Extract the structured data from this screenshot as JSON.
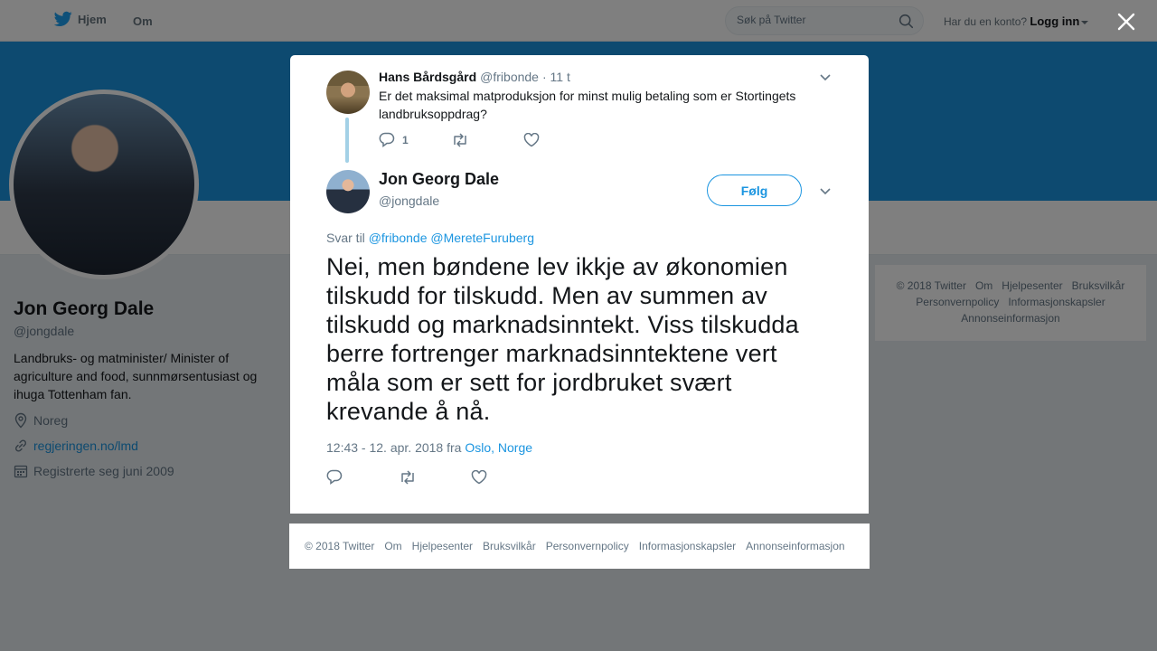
{
  "nav": {
    "home_label": "Hjem",
    "about_label": "Om",
    "search_placeholder": "Søk på Twitter",
    "login_prompt": "Har du en konto?",
    "login_label": "Logg inn"
  },
  "profile": {
    "name": "Jon Georg Dale",
    "handle": "@jongdale",
    "bio": "Landbruks- og matminister/ Minister of agriculture and food, sunnmørsentusiast og ihuga Tottenham fan.",
    "location": "Noreg",
    "website": "regjeringen.no/lmd",
    "joined": "Registrerte seg juni 2009"
  },
  "side_footer": [
    "© 2018 Twitter",
    "Om",
    "Hjelpesenter",
    "Bruksvilkår",
    "Personvernpolicy",
    "Informasjonskapsler",
    "Annonseinformasjon"
  ],
  "parent_tweet": {
    "name": "Hans Bårdsgård",
    "handle": "@fribonde",
    "time": "· 11 t",
    "text": "Er det maksimal matproduksjon for minst mulig betaling som er Stortingets landbruksoppdrag?",
    "reply_count": "1"
  },
  "main_tweet": {
    "name": "Jon Georg Dale",
    "handle": "@jongdale",
    "follow_label": "Følg",
    "reply_prefix": "Svar til",
    "reply_mention1": "@fribonde",
    "reply_mention2": "@MereteFuruberg",
    "text": "Nei, men bøndene lev ikkje av økonomien tilskudd for tilskudd. Men av summen av tilskudd og marknadsinntekt. Viss tilskudda berre fortrenger marknadsinntektene vert måla som er sett for jordbruket svært krevande å nå.",
    "timestamp": "12:43 - 12. apr. 2018 fra",
    "place": "Oslo, Norge"
  },
  "modal_footer": [
    "© 2018 Twitter",
    "Om",
    "Hjelpesenter",
    "Bruksvilkår",
    "Personvernpolicy",
    "Informasjonskapsler",
    "Annonseinformasjon"
  ],
  "colors": {
    "accent": "#1b95e0",
    "thread": "#a3d1e6",
    "muted": "#657786"
  }
}
